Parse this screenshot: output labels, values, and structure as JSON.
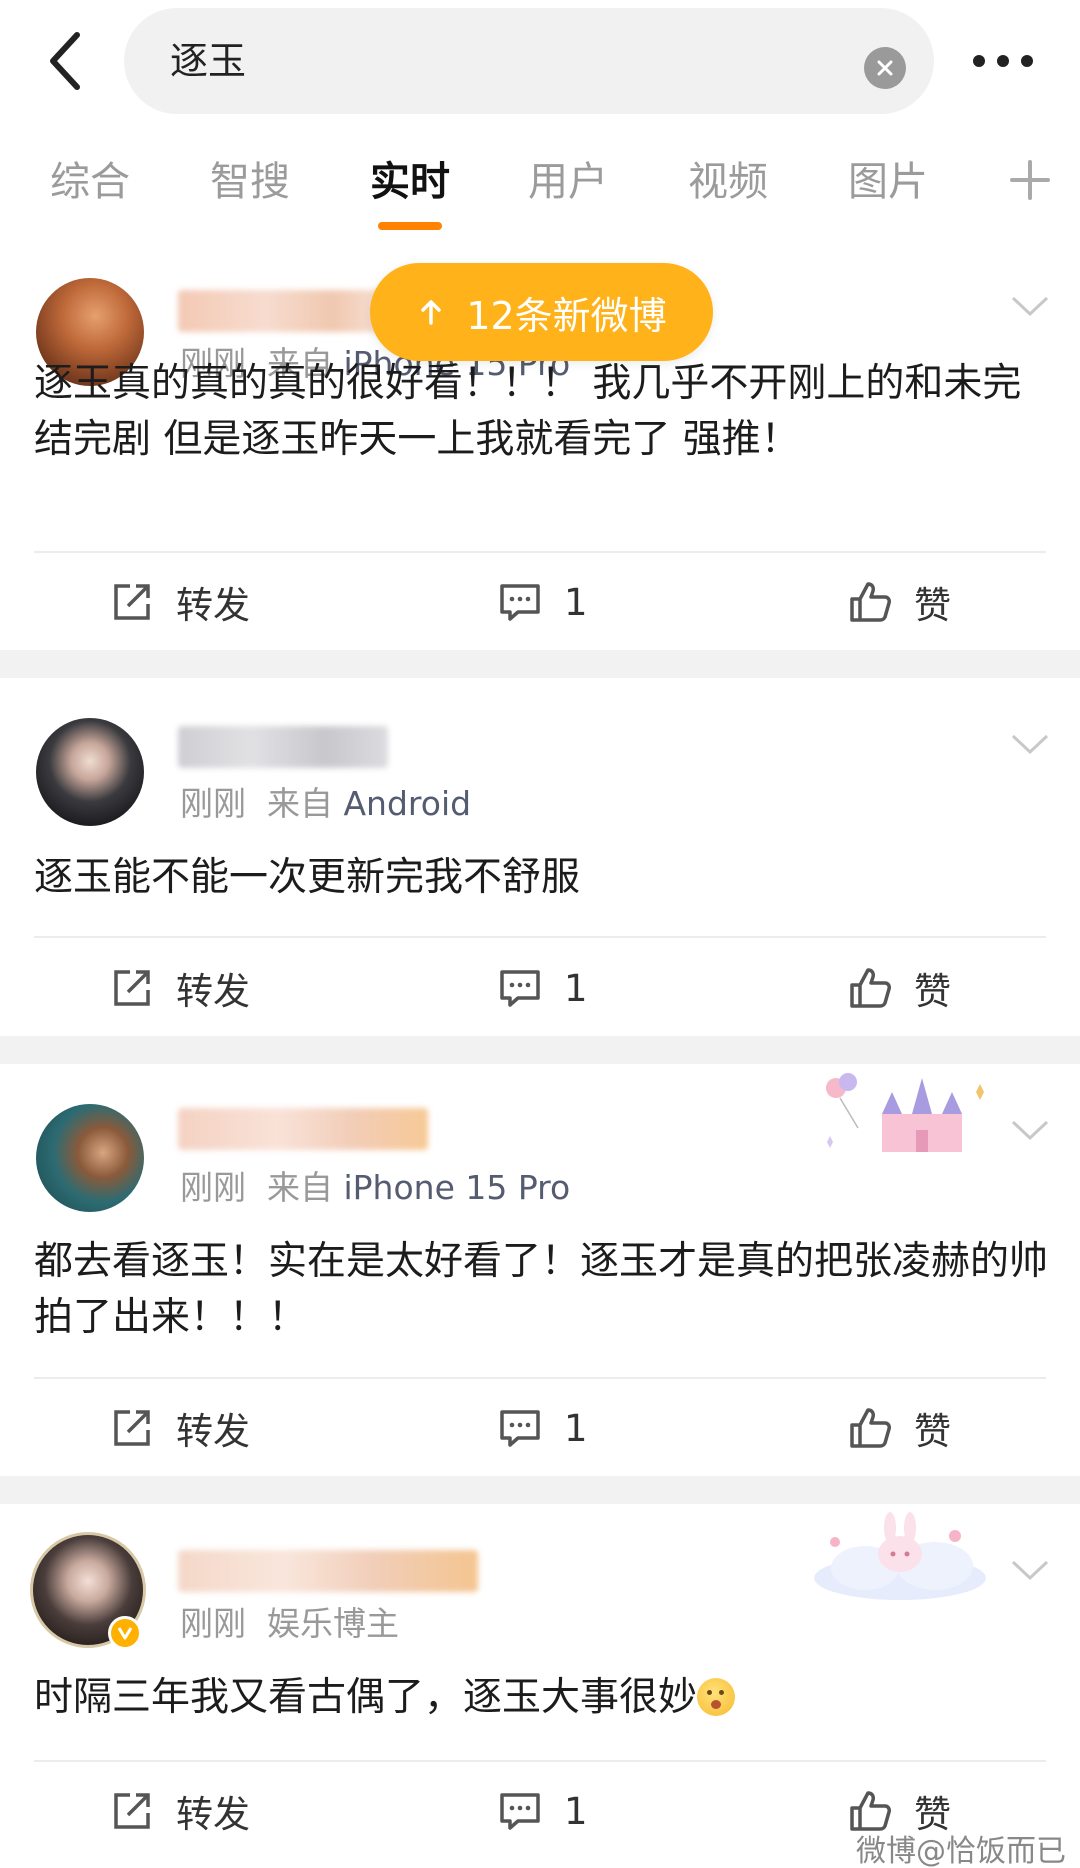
{
  "search": {
    "query": "逐玉"
  },
  "tabs": [
    {
      "label": "综合"
    },
    {
      "label": "智搜"
    },
    {
      "label": "实时"
    },
    {
      "label": "用户"
    },
    {
      "label": "视频"
    },
    {
      "label": "图片"
    }
  ],
  "active_tab": "实时",
  "toast": {
    "label": "12条新微博"
  },
  "posts": [
    {
      "time": "刚刚",
      "source_prefix": "来自",
      "source": "iPhone 15 Pro",
      "content": "逐玉真的真的真的很好看！！！ 我几乎不开刚上的和未完结完剧 但是逐玉昨天一上我就看完了 强推！",
      "repost": "转发",
      "comments": "1",
      "like": "赞"
    },
    {
      "time": "刚刚",
      "source_prefix": "来自",
      "source": "Android",
      "content": "逐玉能不能一次更新完我不舒服",
      "repost": "转发",
      "comments": "1",
      "like": "赞"
    },
    {
      "time": "刚刚",
      "source_prefix": "来自",
      "source": "iPhone 15 Pro",
      "content": "都去看逐玉！实在是太好看了！逐玉才是真的把张凌赫的帅拍了出来！！！",
      "repost": "转发",
      "comments": "1",
      "like": "赞"
    },
    {
      "time": "刚刚",
      "source_prefix": "",
      "source": "娱乐博主",
      "content": "时隔三年我又看古偶了，逐玉大事很妙",
      "repost": "转发",
      "comments": "1",
      "like": "赞"
    }
  ],
  "watermark": "微博@恰饭而已",
  "colors": {
    "accent": "#ff8200",
    "toast": "#ffb21a",
    "source_link": "#555c72"
  }
}
